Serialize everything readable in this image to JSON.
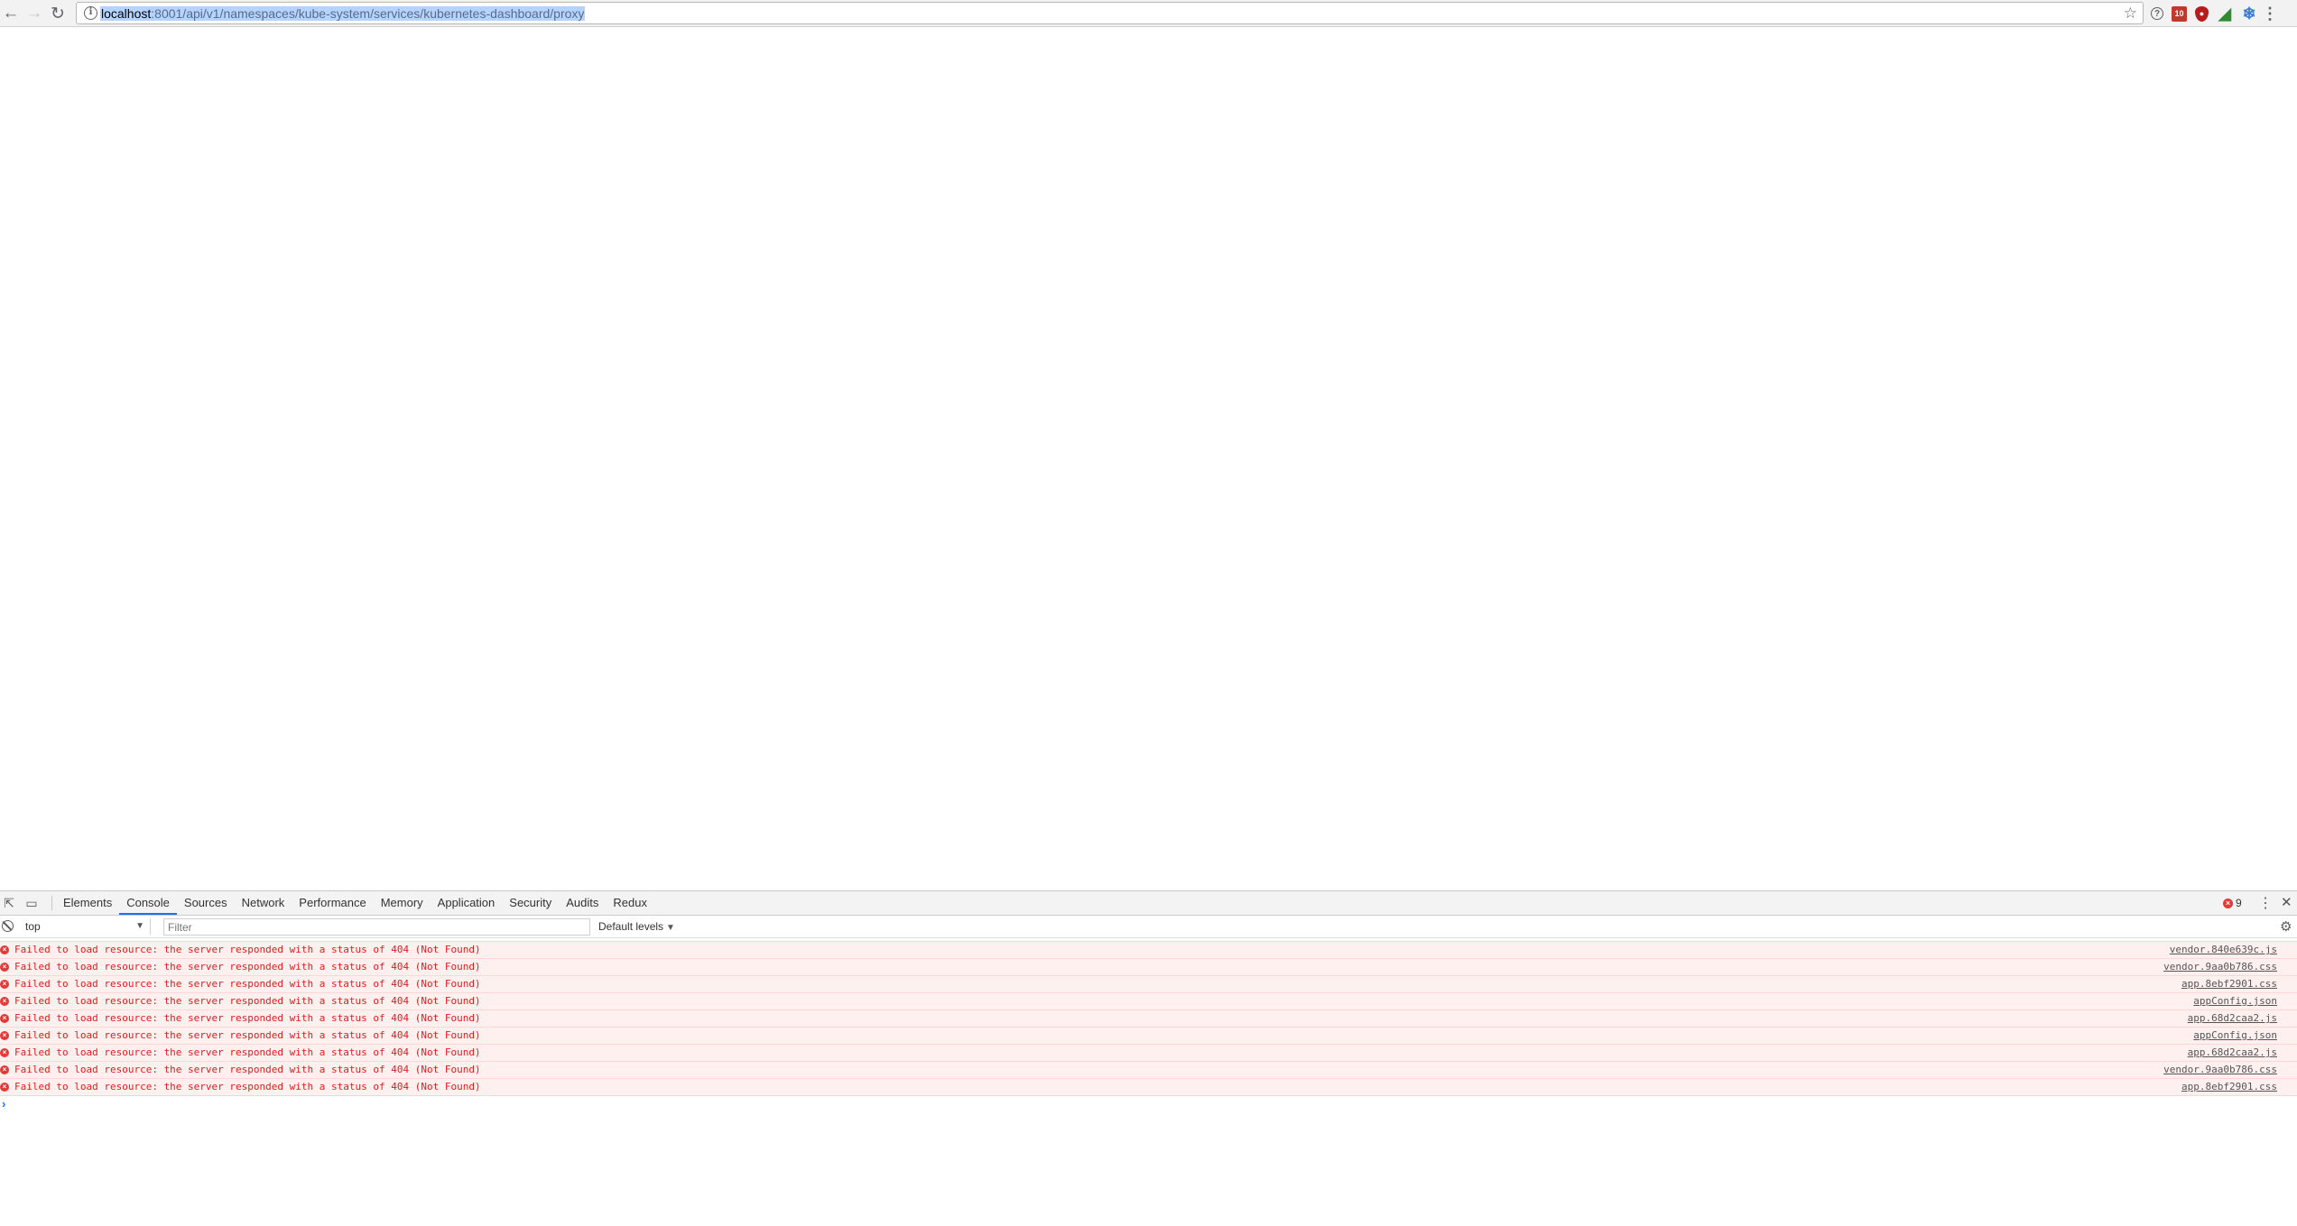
{
  "browser": {
    "url_host": "localhost",
    "url_path": ":8001/api/v1/namespaces/kube-system/services/kubernetes-dashboard/proxy",
    "icons": {
      "back": "arrow-left",
      "forward": "arrow-right",
      "reload": "reload",
      "info": "info",
      "bookmark": "star",
      "calendar_badge": "10"
    }
  },
  "devtools": {
    "tabs": [
      {
        "label": "Elements"
      },
      {
        "label": "Console"
      },
      {
        "label": "Sources"
      },
      {
        "label": "Network"
      },
      {
        "label": "Performance"
      },
      {
        "label": "Memory"
      },
      {
        "label": "Application"
      },
      {
        "label": "Security"
      },
      {
        "label": "Audits"
      },
      {
        "label": "Redux"
      }
    ],
    "active_tab": "Console",
    "error_count": "9",
    "toolbar": {
      "context": "top",
      "filter_placeholder": "Filter",
      "levels": "Default levels"
    },
    "messages": [
      {
        "text": "Failed to load resource: the server responded with a status of 404 (Not Found)",
        "source": "vendor.840e639c.js"
      },
      {
        "text": "Failed to load resource: the server responded with a status of 404 (Not Found)",
        "source": "vendor.9aa0b786.css"
      },
      {
        "text": "Failed to load resource: the server responded with a status of 404 (Not Found)",
        "source": "app.8ebf2901.css"
      },
      {
        "text": "Failed to load resource: the server responded with a status of 404 (Not Found)",
        "source": "appConfig.json"
      },
      {
        "text": "Failed to load resource: the server responded with a status of 404 (Not Found)",
        "source": "app.68d2caa2.js"
      },
      {
        "text": "Failed to load resource: the server responded with a status of 404 (Not Found)",
        "source": "appConfig.json"
      },
      {
        "text": "Failed to load resource: the server responded with a status of 404 (Not Found)",
        "source": "app.68d2caa2.js"
      },
      {
        "text": "Failed to load resource: the server responded with a status of 404 (Not Found)",
        "source": "vendor.9aa0b786.css"
      },
      {
        "text": "Failed to load resource: the server responded with a status of 404 (Not Found)",
        "source": "app.8ebf2901.css"
      }
    ]
  },
  "colors": {
    "error_red": "#e21b1b",
    "error_bg": "#fff0f0",
    "active_tab_underline": "#1a73e8"
  }
}
